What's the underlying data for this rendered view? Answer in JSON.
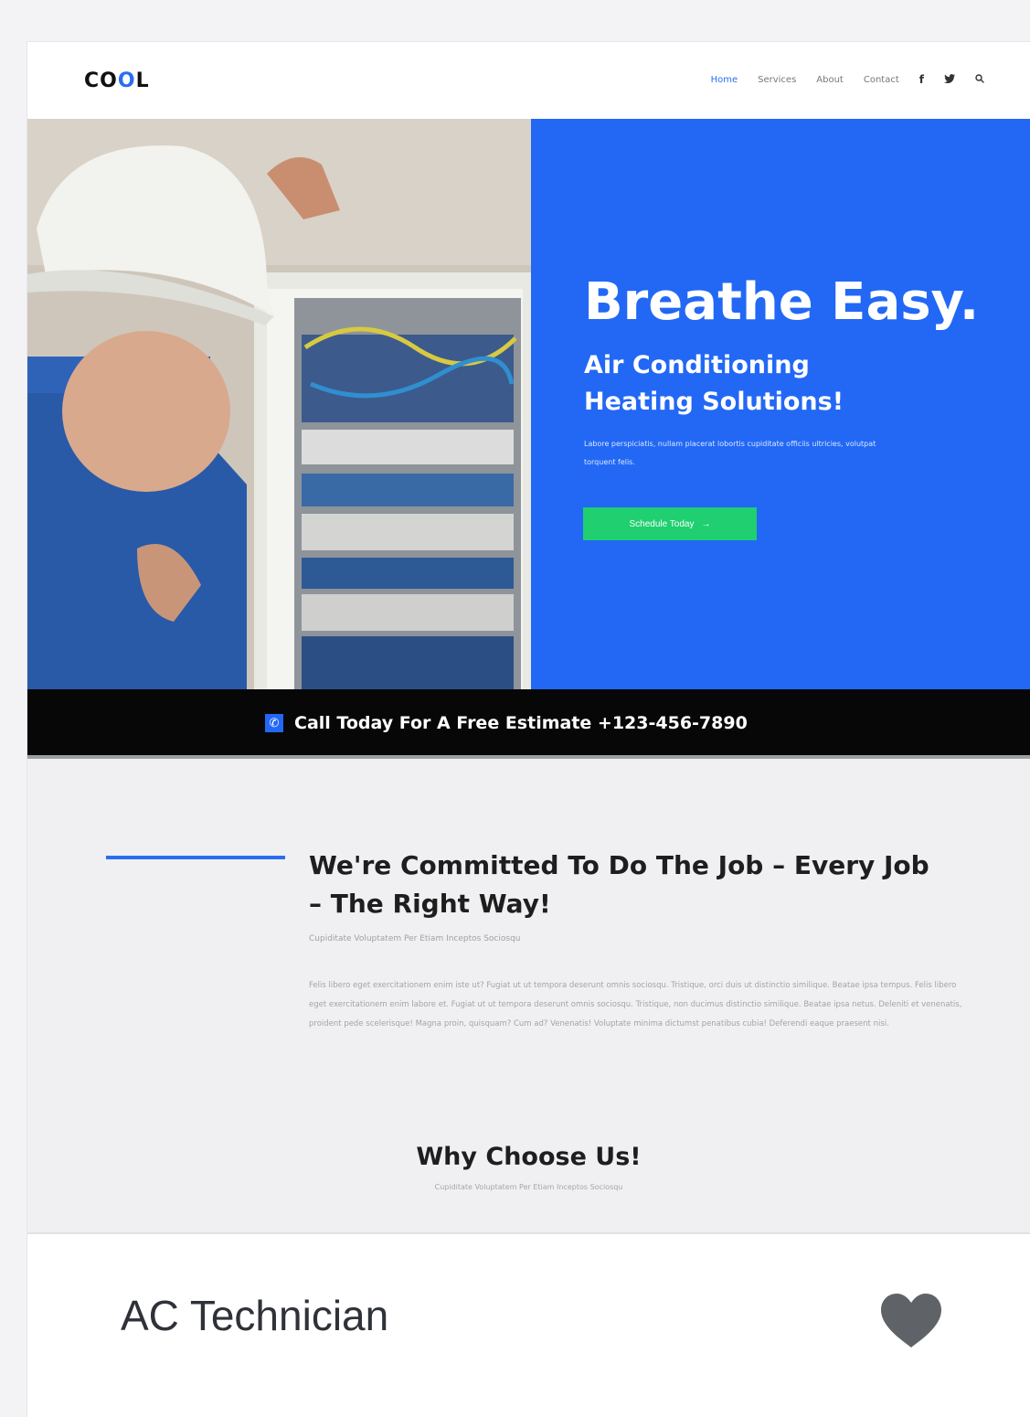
{
  "brand": {
    "logo_prefix": "CO",
    "logo_o": "O",
    "logo_suffix": "L"
  },
  "nav": {
    "items": [
      "Home",
      "Services",
      "About",
      "Contact"
    ],
    "active": "Home",
    "social_icons": [
      "facebook-icon",
      "twitter-icon",
      "search-icon"
    ]
  },
  "hero": {
    "title": "Breathe Easy.",
    "subtitle_line1": "Air Conditioning",
    "subtitle_line2": "Heating Solutions!",
    "text": "Labore perspiciatis, nullam placerat lobortis cupiditate officiis ultricies, volutpat torquent felis.",
    "button_label": "Schedule Today",
    "button_arrow": "→"
  },
  "callbar": {
    "text": "Call Today For A Free Estimate +123-456-7890"
  },
  "commit": {
    "title": "We're Committed To Do The Job – Every Job – The Right Way!",
    "tagline": "Cupiditate Voluptatem Per Etiam Inceptos Sociosqu",
    "body": "Felis libero eget exercitationem enim iste ut? Fugiat ut ut tempora deserunt omnis sociosqu. Tristique, orci duis ut distinctio similique. Beatae ipsa tempus. Felis libero eget exercitationem enim labore et. Fugiat ut ut tempora deserunt omnis sociosqu. Tristique, non ducimus distinctio similique. Beatae ipsa netus. Deleniti et venenatis, proident pede scelerisque! Magna proin, quisquam? Cum ad? Venenatis! Voluptate minima dictumst penatibus cubia! Deferendi eaque praesent nisi.",
    "why_title": "Why Choose Us!",
    "why_sub": "Cupiditate Voluptatem Per Etiam Inceptos Sociosqu"
  },
  "listing": {
    "title": "AC Technician",
    "favorite_icon": "heart-icon"
  },
  "colors": {
    "accent_blue": "#2268f5",
    "cta_green": "#1fcf70",
    "dark_bar": "#070707",
    "heart_gray": "#5f6368"
  }
}
